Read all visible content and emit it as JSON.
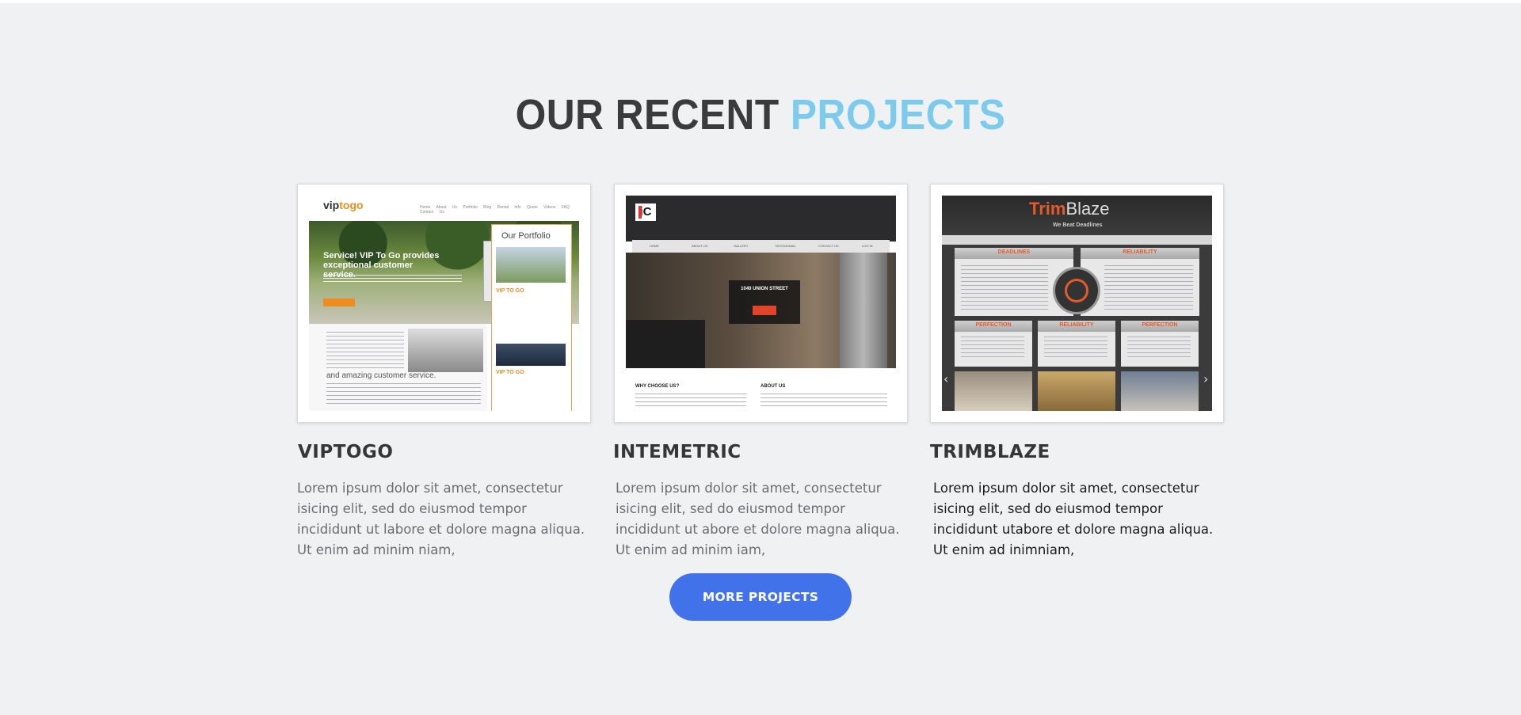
{
  "section": {
    "heading_main": "OUR RECENT",
    "heading_accent": "PROJECTS"
  },
  "projects": [
    {
      "title": "VIPTOGO",
      "description": "Lorem ipsum dolor sit amet, consectetur isicing elit, sed do eiusmod tempor incididunt ut labore et dolore magna aliqua. Ut enim ad minim niam,",
      "preview": {
        "logo_a": "vip",
        "logo_b": "togo",
        "nav": "Home About Us Portfolio Blog Rental Info Quote Videos FAQ Contact Us",
        "hero_text": "Service! VIP To Go provides exceptional customer service.",
        "portfolio_title": "Our Portfolio",
        "portfolio_item_1": "VIP TO GO",
        "portfolio_item_2": "VIP TO GO",
        "body_text": "and amazing customer service."
      }
    },
    {
      "title": "INTEMETRIC",
      "description": "Lorem ipsum dolor sit amet, consectetur isicing elit, sed do eiusmod tempor incididunt ut abore et dolore magna aliqua. Ut enim ad minim iam,",
      "preview": {
        "logo": "iC",
        "nav": [
          "HOME",
          "ABOUT US",
          "GALLERY",
          "TESTIMONIAL",
          "CONTACT US",
          "LOG IN"
        ],
        "hero_text": "1040 UNION STREET",
        "heading_left": "WHY CHOOSE US?",
        "heading_right": "ABOUT US"
      }
    },
    {
      "title": "TRIMBLAZE",
      "description": "Lorem ipsum dolor sit amet, consectetur isicing elit, sed do eiusmod tempor incididunt utabore et dolore magna aliqua. Ut enim ad inimniam,",
      "preview": {
        "logo_a": "Trim",
        "logo_b": "Blaze",
        "tagline": "We Beat Deadlines",
        "panels": [
          "DEADLINES",
          "RELIABILITY"
        ],
        "small_panels": [
          "PERFECTION",
          "RELIABILITY",
          "PERFECTION"
        ]
      }
    }
  ],
  "more_button": "MORE PROJECTS",
  "colors": {
    "heading": "#3a3b3d",
    "accent": "#7dcbec",
    "button": "#4272ea",
    "background": "#f0f1f3"
  }
}
